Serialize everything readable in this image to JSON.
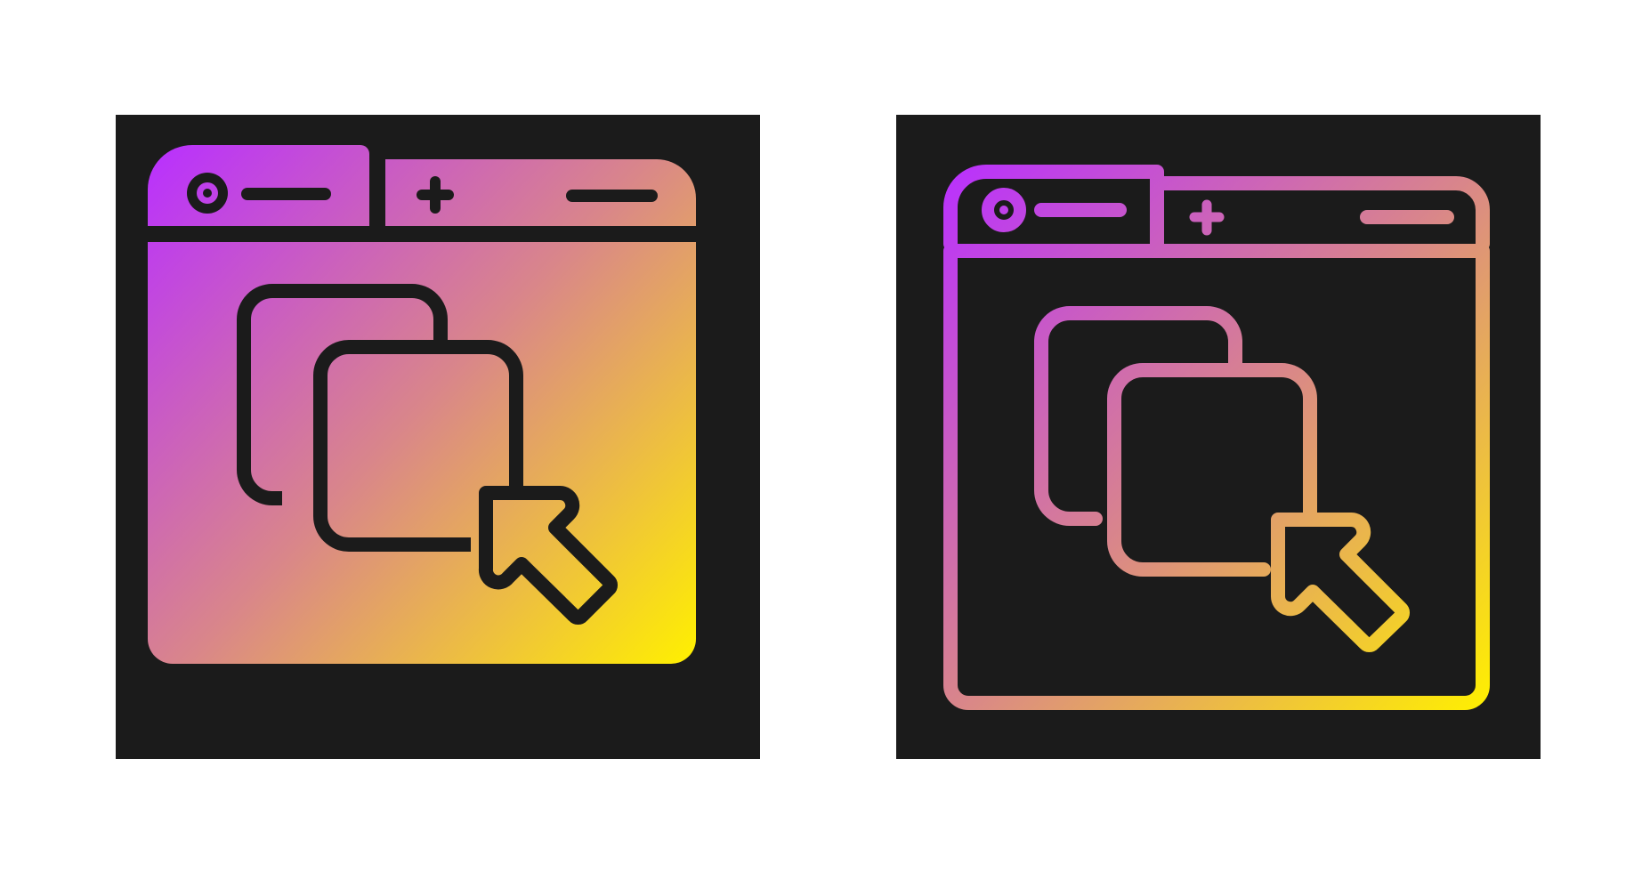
{
  "page": {
    "background": "#ffffff",
    "tile_background": "#1b1b1b"
  },
  "gradient": {
    "start_color": "#b930ff",
    "mid_color": "#d9868a",
    "end_color": "#fff000"
  },
  "icons": [
    {
      "name": "browser-duplicate-window-glyph-icon",
      "style": "glyph"
    },
    {
      "name": "browser-duplicate-window-outline-icon",
      "style": "outline"
    }
  ]
}
